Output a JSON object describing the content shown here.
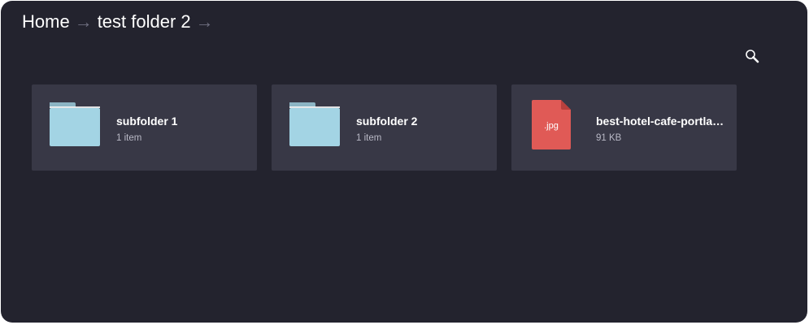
{
  "breadcrumb": {
    "items": [
      "Home",
      "test folder 2"
    ],
    "separator": "→"
  },
  "toolbar": {
    "search_icon": "search-icon"
  },
  "items": [
    {
      "name": "subfolder 1",
      "meta": "1 item",
      "kind": "folder",
      "icon": "folder-icon"
    },
    {
      "name": "subfolder 2",
      "meta": "1 item",
      "kind": "folder",
      "icon": "folder-icon"
    },
    {
      "name": "best-hotel-cafe-portlan…",
      "meta": "91 KB",
      "kind": "file",
      "extension": ".jpg",
      "icon": "jpg-file-icon"
    }
  ],
  "colors": {
    "background": "#23232e",
    "tile": "#383846",
    "folder": "#a3d4e4",
    "folder_tab": "#8cb5c4",
    "file_badge": "#e05a56",
    "file_fold": "#b8403d"
  }
}
